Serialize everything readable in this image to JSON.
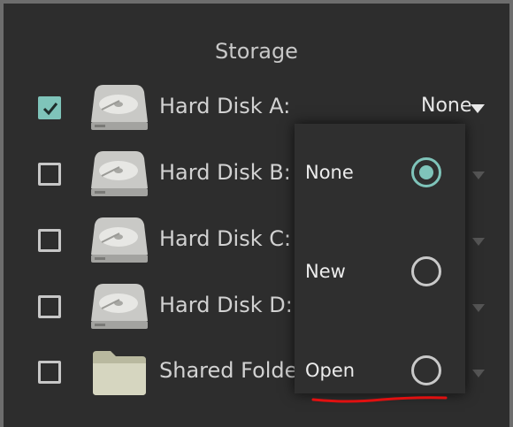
{
  "title": "Storage",
  "colors": {
    "accent": "#7fc4ba",
    "background": "#2d2d2d",
    "annotation": "#e01010"
  },
  "rows": [
    {
      "label": "Hard Disk A:",
      "checked": true,
      "icon": "hard-disk-icon",
      "value": "None"
    },
    {
      "label": "Hard Disk B:",
      "checked": false,
      "icon": "hard-disk-icon"
    },
    {
      "label": "Hard Disk C:",
      "checked": false,
      "icon": "hard-disk-icon"
    },
    {
      "label": "Hard Disk D:",
      "checked": false,
      "icon": "hard-disk-icon"
    },
    {
      "label": "Shared Folde",
      "checked": false,
      "icon": "folder-icon"
    }
  ],
  "popup": {
    "options": [
      {
        "label": "None",
        "selected": true
      },
      {
        "label": "New",
        "selected": false
      },
      {
        "label": "Open",
        "selected": false
      }
    ]
  }
}
